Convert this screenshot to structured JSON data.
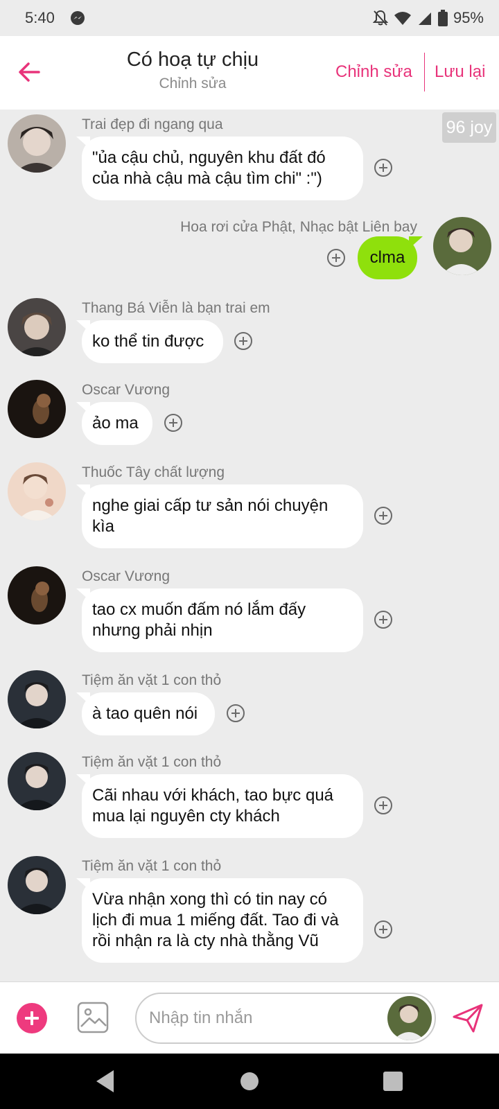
{
  "status_bar": {
    "time": "5:40",
    "battery": "95%",
    "icons": [
      "messenger-icon",
      "bell-off-icon",
      "wifi-icon",
      "signal-icon",
      "battery-icon"
    ]
  },
  "header": {
    "title": "Có hoạ tự chịu",
    "subtitle": "Chỉnh sửa",
    "edit_label": "Chỉnh sửa",
    "save_label": "Lưu lại",
    "accent_color": "#e8337a"
  },
  "chat": {
    "joy_badge": "96 joy",
    "messages": [
      {
        "sender": "Trai đẹp đi ngang qua",
        "text": "\"ủa cậu chủ, nguyên khu đất đó của nhà cậu mà cậu tìm chi\" :\")",
        "mine": false
      },
      {
        "sender": "Hoa rơi cửa Phật, Nhạc bật Liên bay",
        "text": "clma",
        "mine": true
      },
      {
        "sender": "Thang Bá Viễn là bạn trai em",
        "text": "ko thể tin được",
        "mine": false
      },
      {
        "sender": "Oscar Vương",
        "text": "ảo ma",
        "mine": false
      },
      {
        "sender": "Thuốc Tây chất lượng",
        "text": "nghe giai cấp tư sản nói chuyện kìa",
        "mine": false
      },
      {
        "sender": "Oscar Vương",
        "text": "tao cx muốn đấm nó lắm đấy nhưng phải nhịn",
        "mine": false
      },
      {
        "sender": "Tiệm ăn vặt 1 con thỏ",
        "text": "à tao quên nói",
        "mine": false
      },
      {
        "sender": "Tiệm ăn vặt 1 con thỏ",
        "text": "Cãi nhau với khách, tao bực quá mua lại nguyên cty khách",
        "mine": false
      },
      {
        "sender": "Tiệm ăn vặt 1 con thỏ",
        "text": "Vừa nhận xong thì có tin nay có lịch đi mua 1 miếng đất. Tao đi và rồi nhận ra là cty nhà thằng Vũ",
        "mine": false
      }
    ]
  },
  "input_bar": {
    "placeholder": "Nhập tin nhắn",
    "value": ""
  },
  "colors": {
    "accent": "#e8337a",
    "my_bubble": "#8fe00c",
    "background": "#ececec"
  }
}
